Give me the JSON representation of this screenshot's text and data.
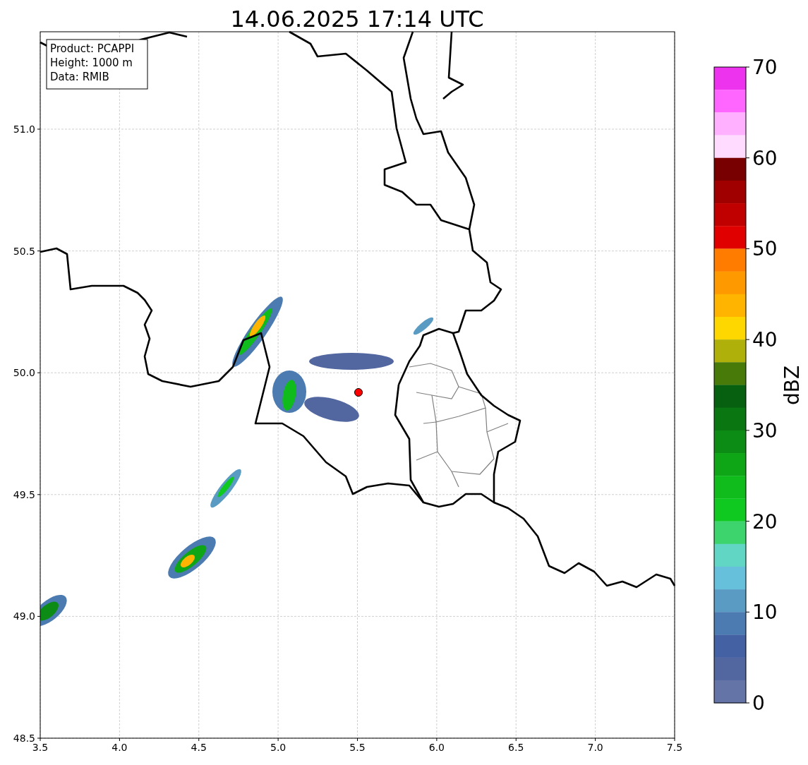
{
  "title": "14.06.2025 17:14 UTC",
  "info_box": [
    "Product: PCAPPI",
    "Height: 1000 m",
    "Data: RMIB"
  ],
  "map": {
    "x_ticks": [
      "3.5",
      "4.0",
      "4.5",
      "5.0",
      "5.5",
      "6.0",
      "6.5",
      "7.0",
      "7.5"
    ],
    "y_ticks": [
      "51.0",
      "50.5",
      "50.0",
      "49.5",
      "49.0",
      "48.5"
    ]
  },
  "colorbar": {
    "label": "dBZ",
    "ticks": [
      "70",
      "60",
      "50",
      "40",
      "30",
      "20",
      "10",
      "0"
    ],
    "levels": [
      {
        "color": "#ee33ee"
      },
      {
        "color": "#ff66ff"
      },
      {
        "color": "#ffb0ff"
      },
      {
        "color": "#ffdcff"
      },
      {
        "color": "#780000"
      },
      {
        "color": "#a00000"
      },
      {
        "color": "#c00000"
      },
      {
        "color": "#e00000"
      },
      {
        "color": "#ff7c00"
      },
      {
        "color": "#ff9900"
      },
      {
        "color": "#ffb400"
      },
      {
        "color": "#ffd700"
      },
      {
        "color": "#afb00a"
      },
      {
        "color": "#487a0a"
      },
      {
        "color": "#075f10"
      },
      {
        "color": "#0a7612"
      },
      {
        "color": "#0c8c15"
      },
      {
        "color": "#0ea617"
      },
      {
        "color": "#10bb1c"
      },
      {
        "color": "#10c920"
      },
      {
        "color": "#3dd46e"
      },
      {
        "color": "#62d6c4"
      },
      {
        "color": "#66c0dc"
      },
      {
        "color": "#5a9bc4"
      },
      {
        "color": "#4b7bb0"
      },
      {
        "color": "#4461a3"
      },
      {
        "color": "#5266a0"
      },
      {
        "color": "#6474a6"
      }
    ]
  }
}
